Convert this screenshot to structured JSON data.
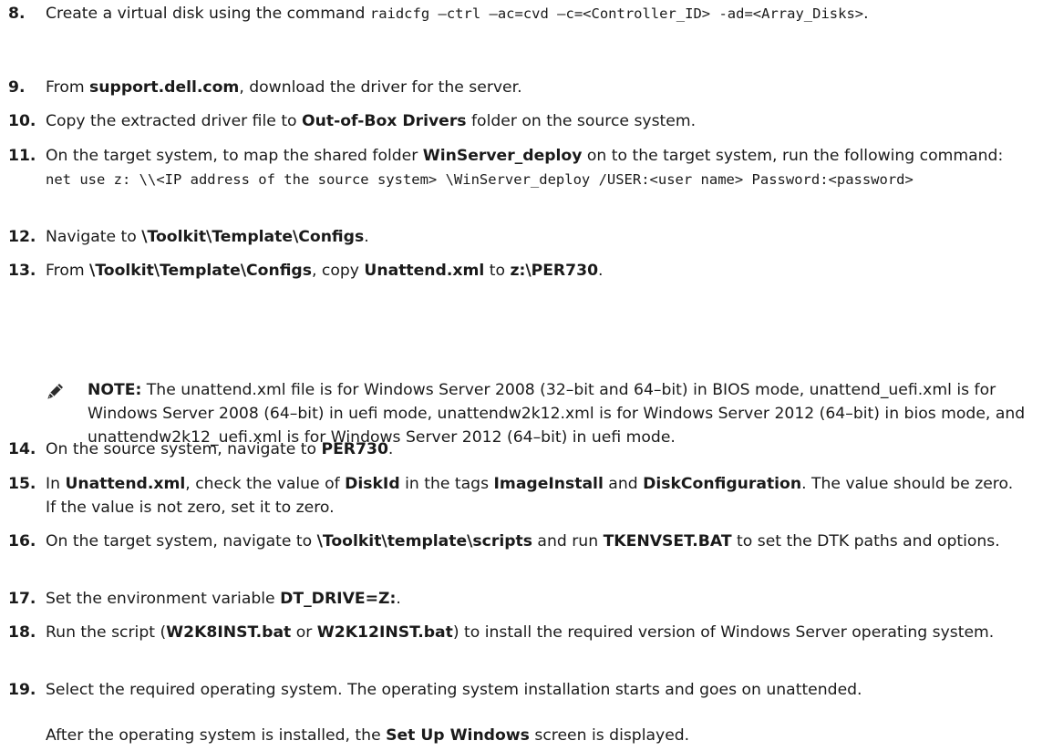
{
  "steps": [
    {
      "num": "8.",
      "parts": [
        {
          "t": "Create a virtual disk using the command "
        },
        {
          "c": "raidcfg –ctrl –ac=cvd –c=<Controller_ID> -ad=<Array_Disks>"
        },
        {
          "t": "."
        }
      ]
    },
    {
      "num": "9.",
      "parts": [
        {
          "t": "From "
        },
        {
          "b": "support.dell.com"
        },
        {
          "t": ", download the driver for the server."
        }
      ]
    },
    {
      "num": "10.",
      "parts": [
        {
          "t": "Copy the extracted driver file to "
        },
        {
          "b": "Out-of-Box Drivers"
        },
        {
          "t": " folder on the source system."
        }
      ]
    },
    {
      "num": "11.",
      "parts": [
        {
          "t": "On the target system, to map the shared folder "
        },
        {
          "b": "WinServer_deploy"
        },
        {
          "t": " on to the target system, run the following command: "
        },
        {
          "c": "net use z: \\\\<IP address of the source system> \\WinServer_deploy /USER:<user name> Password:<password>"
        }
      ]
    },
    {
      "num": "12.",
      "parts": [
        {
          "t": "Navigate to "
        },
        {
          "b": "\\Toolkit\\Template\\Configs"
        },
        {
          "t": "."
        }
      ]
    },
    {
      "num": "13.",
      "parts": [
        {
          "t": "From "
        },
        {
          "b": "\\Toolkit\\Template\\Configs"
        },
        {
          "t": ", copy "
        },
        {
          "b": "Unattend.xml"
        },
        {
          "t": "  to "
        },
        {
          "b": "z:\\PER730"
        },
        {
          "t": "."
        }
      ]
    },
    {
      "num": "14.",
      "parts": [
        {
          "t": "On the source system, navigate to "
        },
        {
          "b": "PER730"
        },
        {
          "t": "."
        }
      ]
    },
    {
      "num": "15.",
      "parts": [
        {
          "t": "In "
        },
        {
          "b": "Unattend.xml"
        },
        {
          "t": ", check the value of  "
        },
        {
          "b": "DiskId"
        },
        {
          "t": " in the tags "
        },
        {
          "b": "ImageInstall"
        },
        {
          "t": " and "
        },
        {
          "b": "DiskConfiguration"
        },
        {
          "t": ". The value should be zero. If the value is not zero, set it to zero."
        }
      ]
    },
    {
      "num": "16.",
      "parts": [
        {
          "t": "On the target system, navigate to "
        },
        {
          "b": "\\Toolkit\\template\\scripts"
        },
        {
          "t": " and run "
        },
        {
          "b": "TKENVSET.BAT"
        },
        {
          "t": " to set the DTK paths and options."
        }
      ]
    },
    {
      "num": "17.",
      "parts": [
        {
          "t": "Set the environment variable "
        },
        {
          "b": "DT_DRIVE=Z:"
        },
        {
          "t": "."
        }
      ]
    },
    {
      "num": "18.",
      "parts": [
        {
          "t": "Run the script ("
        },
        {
          "b": "W2K8INST.bat"
        },
        {
          "t": " or "
        },
        {
          "b": "W2K12INST.bat"
        },
        {
          "t": ") to install the required version of Windows Server operating system."
        }
      ]
    },
    {
      "num": "19.",
      "parts": [
        {
          "t": "Select the required operating system. The operating system installation starts and goes on unattended."
        }
      ]
    }
  ],
  "note": {
    "label": "NOTE:",
    "text": " The unattend.xml file is for Windows Server 2008 (32–bit and 64–bit) in BIOS mode, unattend_uefi.xml is for Windows Server 2008 (64–bit) in uefi mode, unattendw2k12.xml is for Windows Server 2012 (64–bit) in bios mode, and unattendw2k12_uefi.xml is for Windows Server 2012 (64–bit) in uefi mode.",
    "icon": "pencil-icon"
  },
  "after": [
    {
      "t": "After the operating system is installed, the "
    },
    {
      "b": "Set Up Windows"
    },
    {
      "t": " screen is displayed."
    }
  ]
}
